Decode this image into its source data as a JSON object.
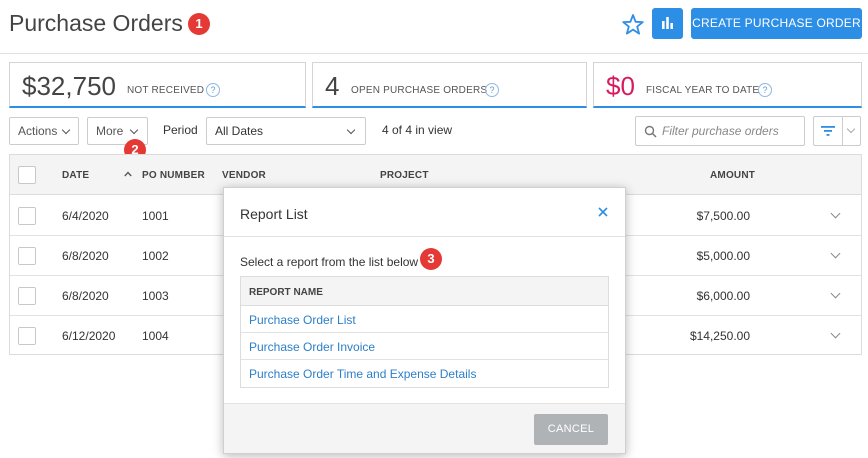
{
  "header": {
    "title": "Purchase Orders",
    "create_label": "CREATE PURCHASE ORDER",
    "icons": [
      "star-icon",
      "bar-chart-icon"
    ]
  },
  "callouts": [
    "1",
    "2",
    "3"
  ],
  "stats": [
    {
      "value": "$32,750",
      "label": "NOT RECEIVED",
      "color": "#444444"
    },
    {
      "value": "4",
      "label": "OPEN PURCHASE ORDERS",
      "color": "#444444"
    },
    {
      "value": "$0",
      "label": "FISCAL YEAR TO DATE",
      "color": "#d81b60"
    }
  ],
  "help_glyph": "?",
  "toolbar": {
    "actions_label": "Actions",
    "more_label": "More",
    "period_label": "Period",
    "period_value": "All Dates",
    "count_text": "4 of 4 in view",
    "search_placeholder": "Filter purchase orders"
  },
  "table": {
    "columns": [
      "DATE",
      "PO NUMBER",
      "VENDOR",
      "PROJECT",
      "AMOUNT"
    ],
    "rows": [
      {
        "date": "6/4/2020",
        "po": "1001",
        "amount": "$7,500.00"
      },
      {
        "date": "6/8/2020",
        "po": "1002",
        "amount": "$5,000.00"
      },
      {
        "date": "6/8/2020",
        "po": "1003",
        "amount": "$6,000.00"
      },
      {
        "date": "6/12/2020",
        "po": "1004",
        "amount": "$14,250.00"
      }
    ]
  },
  "modal": {
    "title": "Report List",
    "intro": "Select a report from the list below",
    "column_header": "REPORT NAME",
    "reports": [
      "Purchase Order List",
      "Purchase Order Invoice",
      "Purchase Order Time and Expense Details"
    ],
    "cancel_label": "CANCEL"
  },
  "colors": {
    "accent": "#2d8ee6",
    "badge": "#e53935",
    "link": "#2d7fc8"
  }
}
